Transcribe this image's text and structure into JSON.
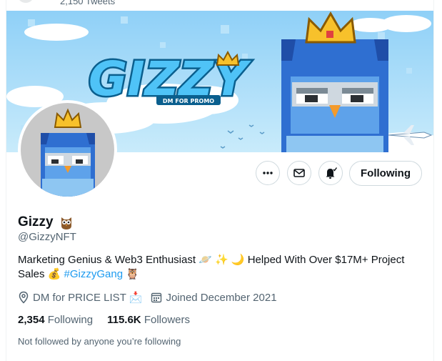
{
  "header": {
    "tweet_count": "2,150 Tweets"
  },
  "banner": {
    "logo_text": "GIZZY",
    "tagline": "DM FOR PROMO"
  },
  "actions": {
    "follow_label": "Following"
  },
  "profile": {
    "name": "Gizzy",
    "handle": "@GizzyNFT",
    "bio_text": "Marketing Genius & Web3 Enthusiast 🪐 ✨ 🌙 Helped With Over $17M+ Project Sales 💰 ",
    "bio_hashtag": "#GizzyGang",
    "bio_trailing": " 🦉",
    "location": "DM for PRICE LIST 📩",
    "joined": "Joined December 2021",
    "following_count": "2,354",
    "following_label": "Following",
    "followers_count": "115.6K",
    "followers_label": "Followers",
    "not_followed_note": "Not followed by anyone you’re following"
  },
  "icons": {
    "more": "more-dots-icon",
    "message": "envelope-icon",
    "notify": "bell-icon",
    "location": "location-pin-icon",
    "calendar": "calendar-icon",
    "owl": "owl-emoji-icon"
  },
  "colors": {
    "accent": "#1d9bf0",
    "text": "#0f1419",
    "muted": "#536471",
    "banner_sky": "#9fd3f5"
  }
}
